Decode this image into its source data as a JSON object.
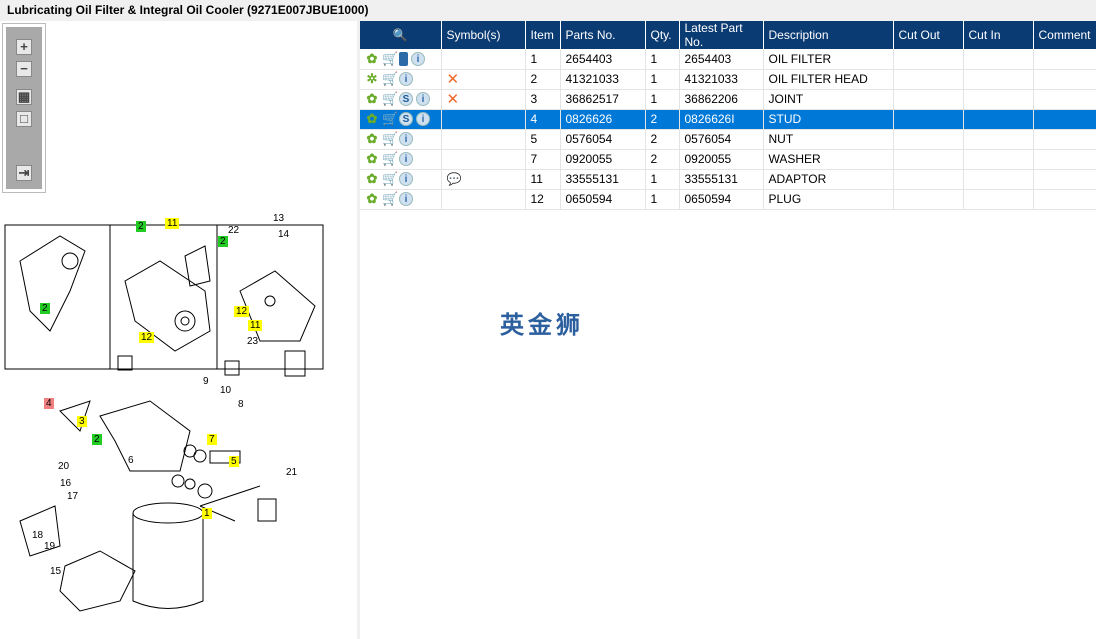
{
  "title": "Lubricating Oil Filter & Integral Oil Cooler (9271E007JBUE1000)",
  "toolbar": {
    "zoom_in": "+",
    "zoom_out": "−",
    "fit": "▦",
    "actual": "□",
    "export": "⇥"
  },
  "table": {
    "headers": [
      "",
      "Symbol(s)",
      "Item",
      "Parts No.",
      "Qty.",
      "Latest Part No.",
      "Description",
      "Cut Out",
      "Cut In",
      "Comment"
    ],
    "rows": [
      {
        "icons": [
          "gear",
          "cart",
          "book",
          "info"
        ],
        "symbol": "",
        "item": "1",
        "part": "2654403",
        "qty": "1",
        "latest": "2654403",
        "desc": "OIL FILTER",
        "selected": false
      },
      {
        "icons": [
          "gears",
          "cart",
          "info"
        ],
        "symbol": "✕",
        "item": "2",
        "part": "41321033",
        "qty": "1",
        "latest": "41321033",
        "desc": "OIL FILTER HEAD",
        "selected": false
      },
      {
        "icons": [
          "gear",
          "cart",
          "s",
          "info"
        ],
        "symbol": "✕",
        "item": "3",
        "part": "36862517",
        "qty": "1",
        "latest": "36862206",
        "desc": "JOINT",
        "selected": false
      },
      {
        "icons": [
          "gear",
          "cart",
          "s",
          "info"
        ],
        "symbol": "",
        "item": "4",
        "part": "0826626",
        "qty": "2",
        "latest": "0826626I",
        "desc": "STUD",
        "selected": true
      },
      {
        "icons": [
          "gear",
          "cart",
          "info"
        ],
        "symbol": "",
        "item": "5",
        "part": "0576054",
        "qty": "2",
        "latest": "0576054",
        "desc": "NUT",
        "selected": false
      },
      {
        "icons": [
          "gear",
          "cart",
          "info"
        ],
        "symbol": "",
        "item": "7",
        "part": "0920055",
        "qty": "2",
        "latest": "0920055",
        "desc": "WASHER",
        "selected": false
      },
      {
        "icons": [
          "gear",
          "cart",
          "info"
        ],
        "symbol": "💬",
        "item": "11",
        "part": "33555131",
        "qty": "1",
        "latest": "33555131",
        "desc": "ADAPTOR",
        "selected": false
      },
      {
        "icons": [
          "gear",
          "cart",
          "info"
        ],
        "symbol": "",
        "item": "12",
        "part": "0650594",
        "qty": "1",
        "latest": "0650594",
        "desc": "PLUG",
        "selected": false
      }
    ]
  },
  "watermark": "英金狮",
  "callouts": [
    "2",
    "2",
    "11",
    "12",
    "22",
    "13",
    "14",
    "2",
    "12",
    "11",
    "23",
    "4",
    "3",
    "2",
    "9",
    "10",
    "8",
    "7",
    "6",
    "5",
    "21",
    "20",
    "16",
    "17",
    "18",
    "19",
    "1",
    "15"
  ],
  "colors": {
    "header": "#0b3b73",
    "selected": "#0078d7",
    "green": "#22cc22",
    "yellow": "#ffff00",
    "red": "#f08080"
  }
}
